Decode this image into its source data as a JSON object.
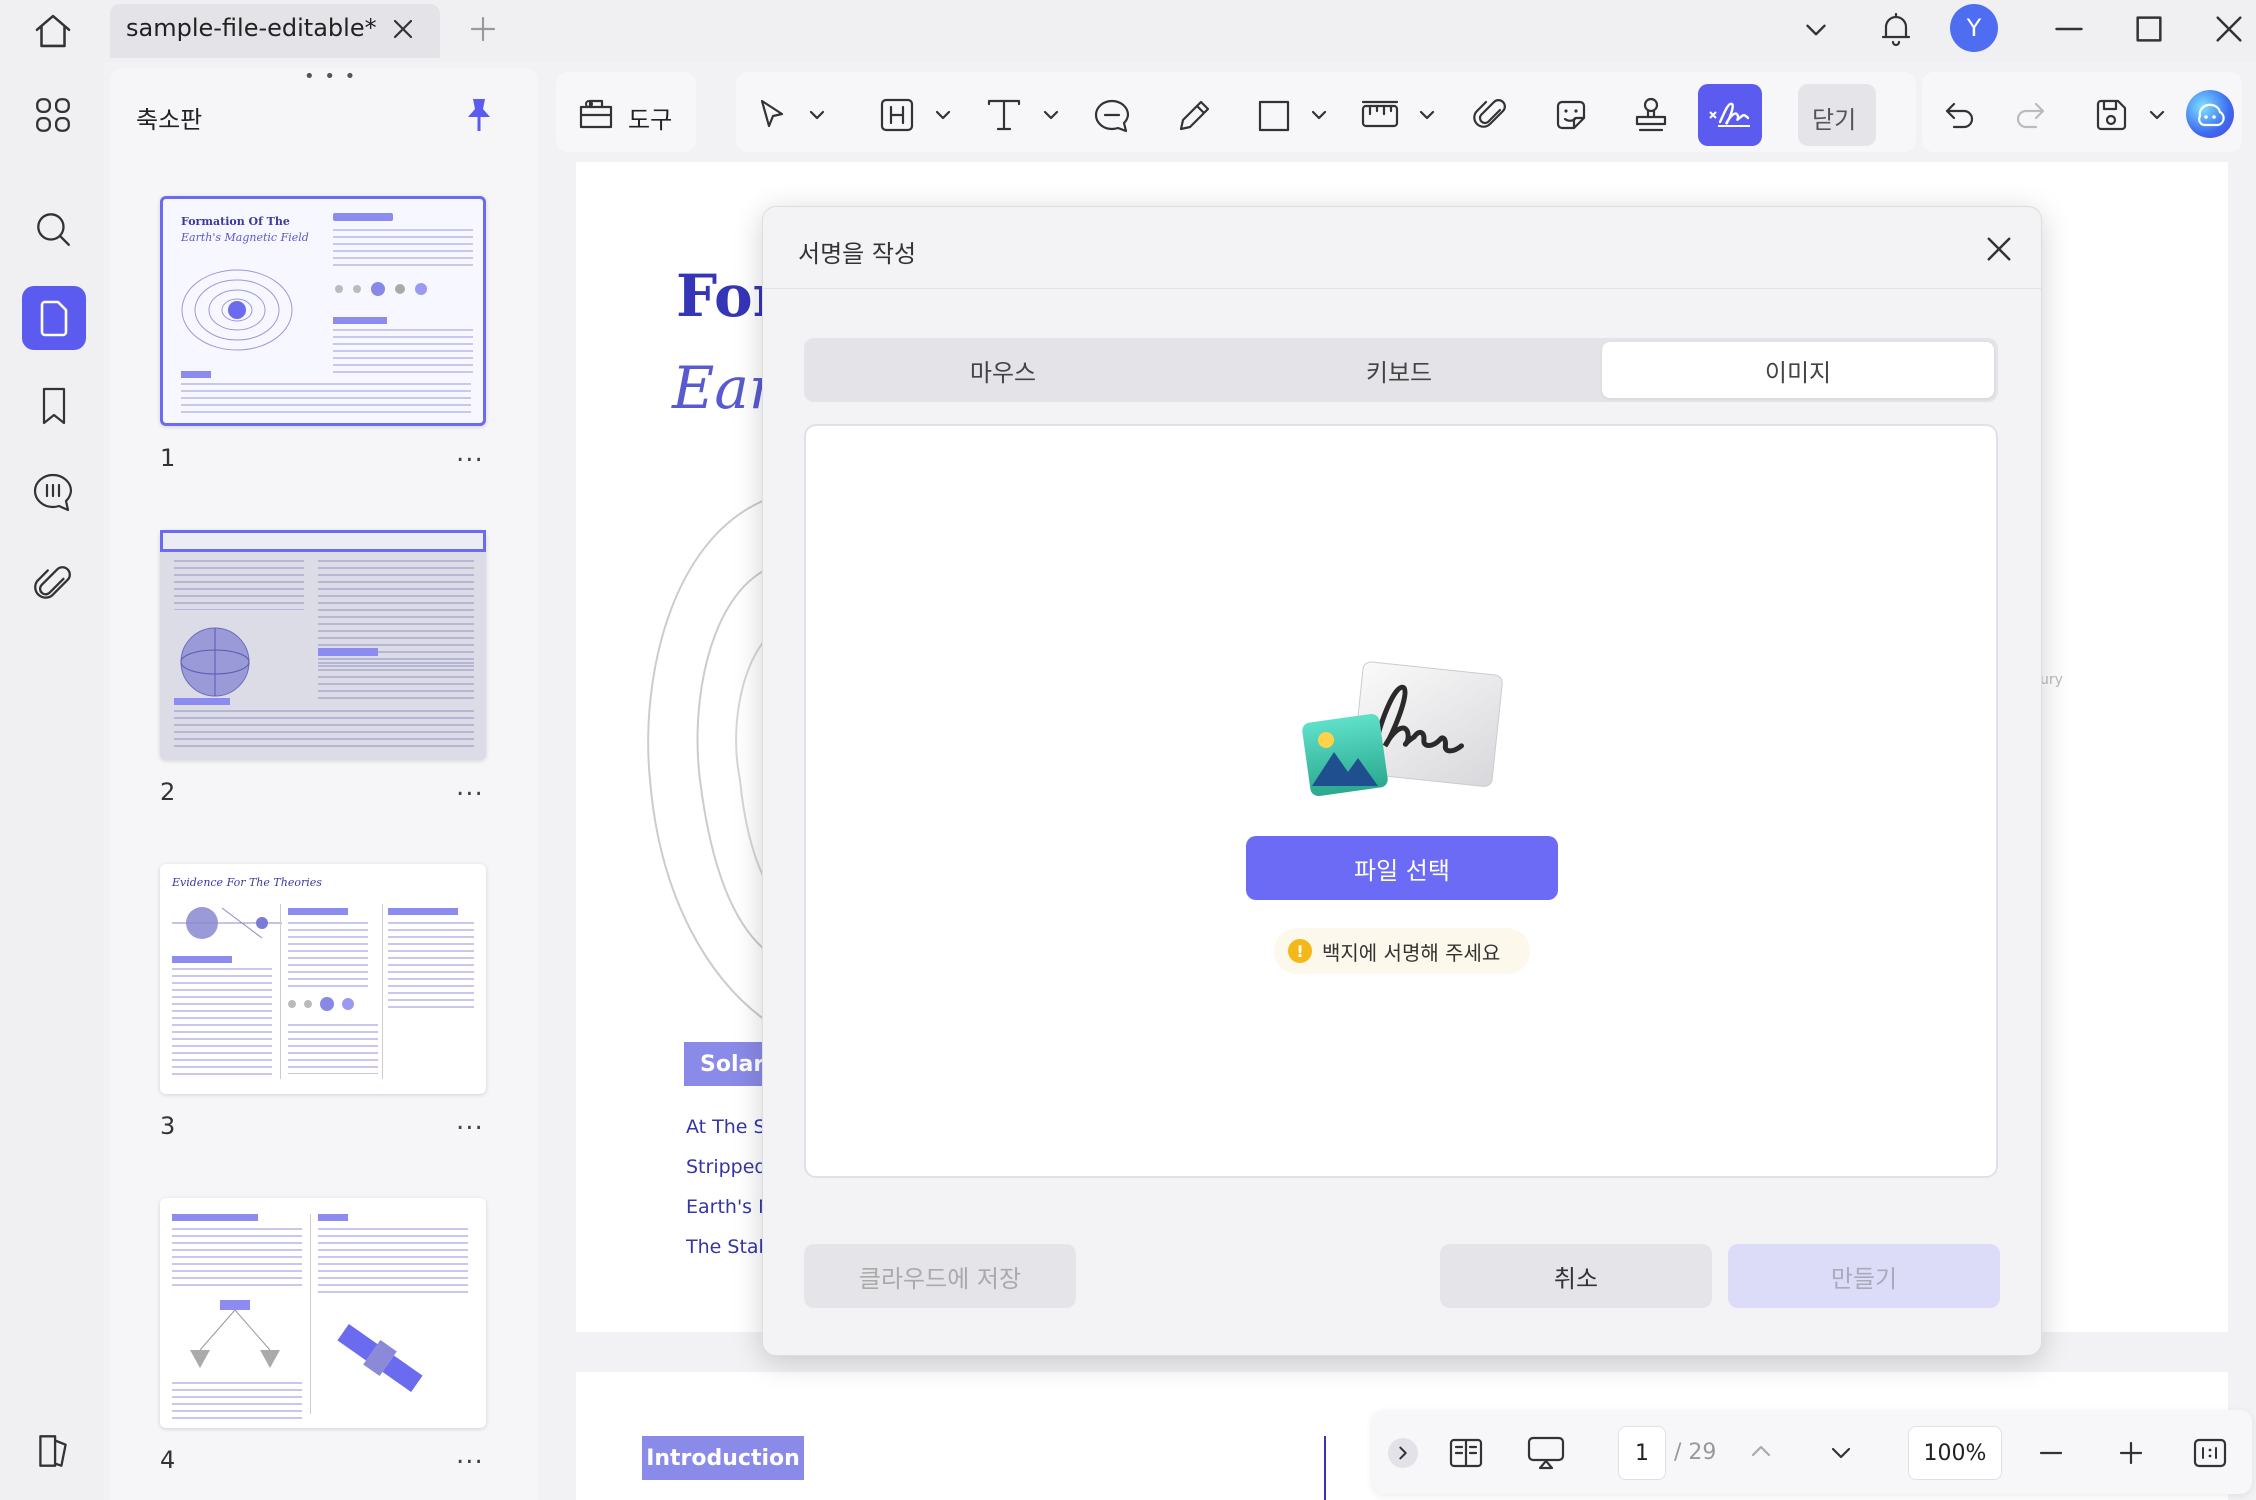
{
  "titlebar": {
    "tab_title": "sample-file-editable*",
    "avatar_letter": "Y",
    "accent": "#5b5bf0"
  },
  "sidebar": {
    "panel_title": "축소판",
    "pages": [
      {
        "number": "1",
        "heading_line1": "Formation Of The",
        "heading_line2": "Earth's Magnetic Field",
        "more": "..."
      },
      {
        "number": "2",
        "more": "..."
      },
      {
        "number": "3",
        "heading": "Evidence For The Theories",
        "more": "..."
      },
      {
        "number": "4",
        "more": "..."
      }
    ]
  },
  "toolbar": {
    "tools_label": "도구",
    "close_label": "닫기"
  },
  "document": {
    "title_fragment_1": "For",
    "title_fragment_2": "Ear",
    "section_badge": "Solar",
    "lines": [
      "At The Sa",
      "Stripped ,",
      "Earth's M",
      "The Stab"
    ],
    "side_text": "ury",
    "bottom_badge": "Introduction"
  },
  "dialog": {
    "title": "서명을 작성",
    "tabs": [
      {
        "label": "마우스",
        "active": false
      },
      {
        "label": "키보드",
        "active": false
      },
      {
        "label": "이미지",
        "active": true
      }
    ],
    "choose_file_label": "파일 선택",
    "hint_text": "백지에 서명해 주세요",
    "save_cloud_label": "클라우드에 저장",
    "cancel_label": "취소",
    "create_label": "만들기"
  },
  "statusbar": {
    "page_current": "1",
    "page_total": "/ 29",
    "zoom": "100%"
  }
}
